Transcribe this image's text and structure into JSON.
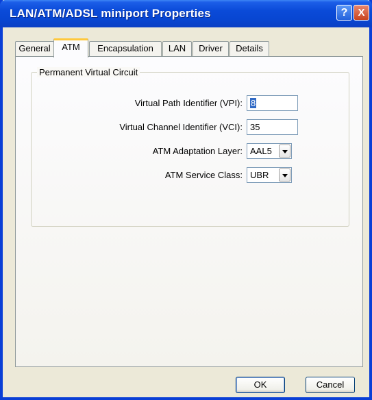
{
  "window": {
    "title": "LAN/ATM/ADSL miniport Properties",
    "help_label": "?",
    "close_label": "X"
  },
  "tabs": [
    {
      "label": "General",
      "active": false
    },
    {
      "label": "ATM",
      "active": true
    },
    {
      "label": "Encapsulation",
      "active": false
    },
    {
      "label": "LAN",
      "active": false
    },
    {
      "label": "Driver",
      "active": false
    },
    {
      "label": "Details",
      "active": false
    }
  ],
  "pvc": {
    "group_label": "Permanent Virtual Circuit",
    "vpi_label": "Virtual Path Identifier (VPI):",
    "vpi_value": "8",
    "vci_label": "Virtual Channel Identifier (VCI):",
    "vci_value": "35",
    "aal_label": "ATM Adaptation Layer:",
    "aal_value": "AAL5",
    "service_label": "ATM Service Class:",
    "service_value": "UBR"
  },
  "buttons": {
    "ok": "OK",
    "cancel": "Cancel"
  },
  "colors": {
    "titlebar": "#0a4ad8",
    "window_bg": "#ece9d8",
    "active_tab_accent": "#ffc83c",
    "selection": "#316ac5"
  }
}
